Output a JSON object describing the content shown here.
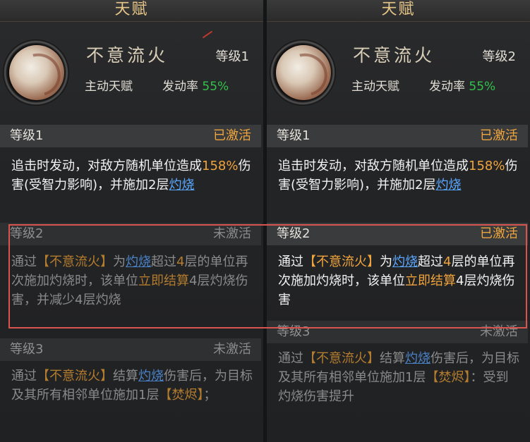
{
  "tab_title": "天赋",
  "panels": [
    {
      "skill_name": "不意流火",
      "level_label": "等级1",
      "skill_type": "主动天赋",
      "trigger_label": "发动率",
      "trigger_value": "55%",
      "sections": [
        {
          "label": "等级1",
          "status": "已激活"
        },
        {
          "label": "等级2",
          "status": "未激活"
        },
        {
          "label": "等级3",
          "status": "未激活"
        }
      ],
      "desc1": {
        "t1": "追击时发动，对敌方随机单位造成",
        "n1": "158%",
        "t2": "伤害(受智力影响)，并施加2层",
        "link": "灼烧"
      },
      "desc2": {
        "t1": "通过",
        "kw": "【不意流火】",
        "t2": "为",
        "link": "灼烧",
        "t3": "超过",
        "n1": "4",
        "t4": "层的单位再次施加灼烧时，该单位",
        "kw2": "立即结算",
        "t5": "4层灼烧伤害，并减少4层灼烧"
      },
      "desc3": {
        "t1": "通过",
        "kw": "【不意流火】",
        "t2": "结算",
        "link": "灼烧",
        "t3": "伤害后，为目标及其所有相邻单位施加1层",
        "kw2": "【焚烬】",
        "t4": "；"
      }
    },
    {
      "skill_name": "不意流火",
      "level_label": "等级2",
      "skill_type": "主动天赋",
      "trigger_label": "发动率",
      "trigger_value": "55%",
      "sections": [
        {
          "label": "等级1",
          "status": "已激活"
        },
        {
          "label": "等级2",
          "status": "已激活"
        },
        {
          "label": "等级3",
          "status": "未激活"
        }
      ],
      "desc1": {
        "t1": "追击时发动，对敌方随机单位造成",
        "n1": "158%",
        "t2": "伤害(受智力影响)，并施加2层",
        "link": "灼烧"
      },
      "desc2": {
        "t1": "通过",
        "kw": "【不意流火】",
        "t2": "为",
        "link": "灼烧",
        "t3": "超过",
        "n1": "4",
        "t4": "层的单位再次施加灼烧时，该单位",
        "kw2": "立即结算",
        "t5": "4层灼烧伤害"
      },
      "desc3": {
        "t1": "通过",
        "kw": "【不意流火】",
        "t2": "结算",
        "link": "灼烧",
        "t3": "伤害后，为目标及其所有相邻单位施加1层",
        "kw2": "【焚烬】",
        "t4": "：受到灼烧伤害提升"
      }
    }
  ],
  "colors": {
    "accent": "#f0a43c",
    "link": "#5aa7ff",
    "rate": "#33c24a",
    "highlight": "#d9534f"
  }
}
